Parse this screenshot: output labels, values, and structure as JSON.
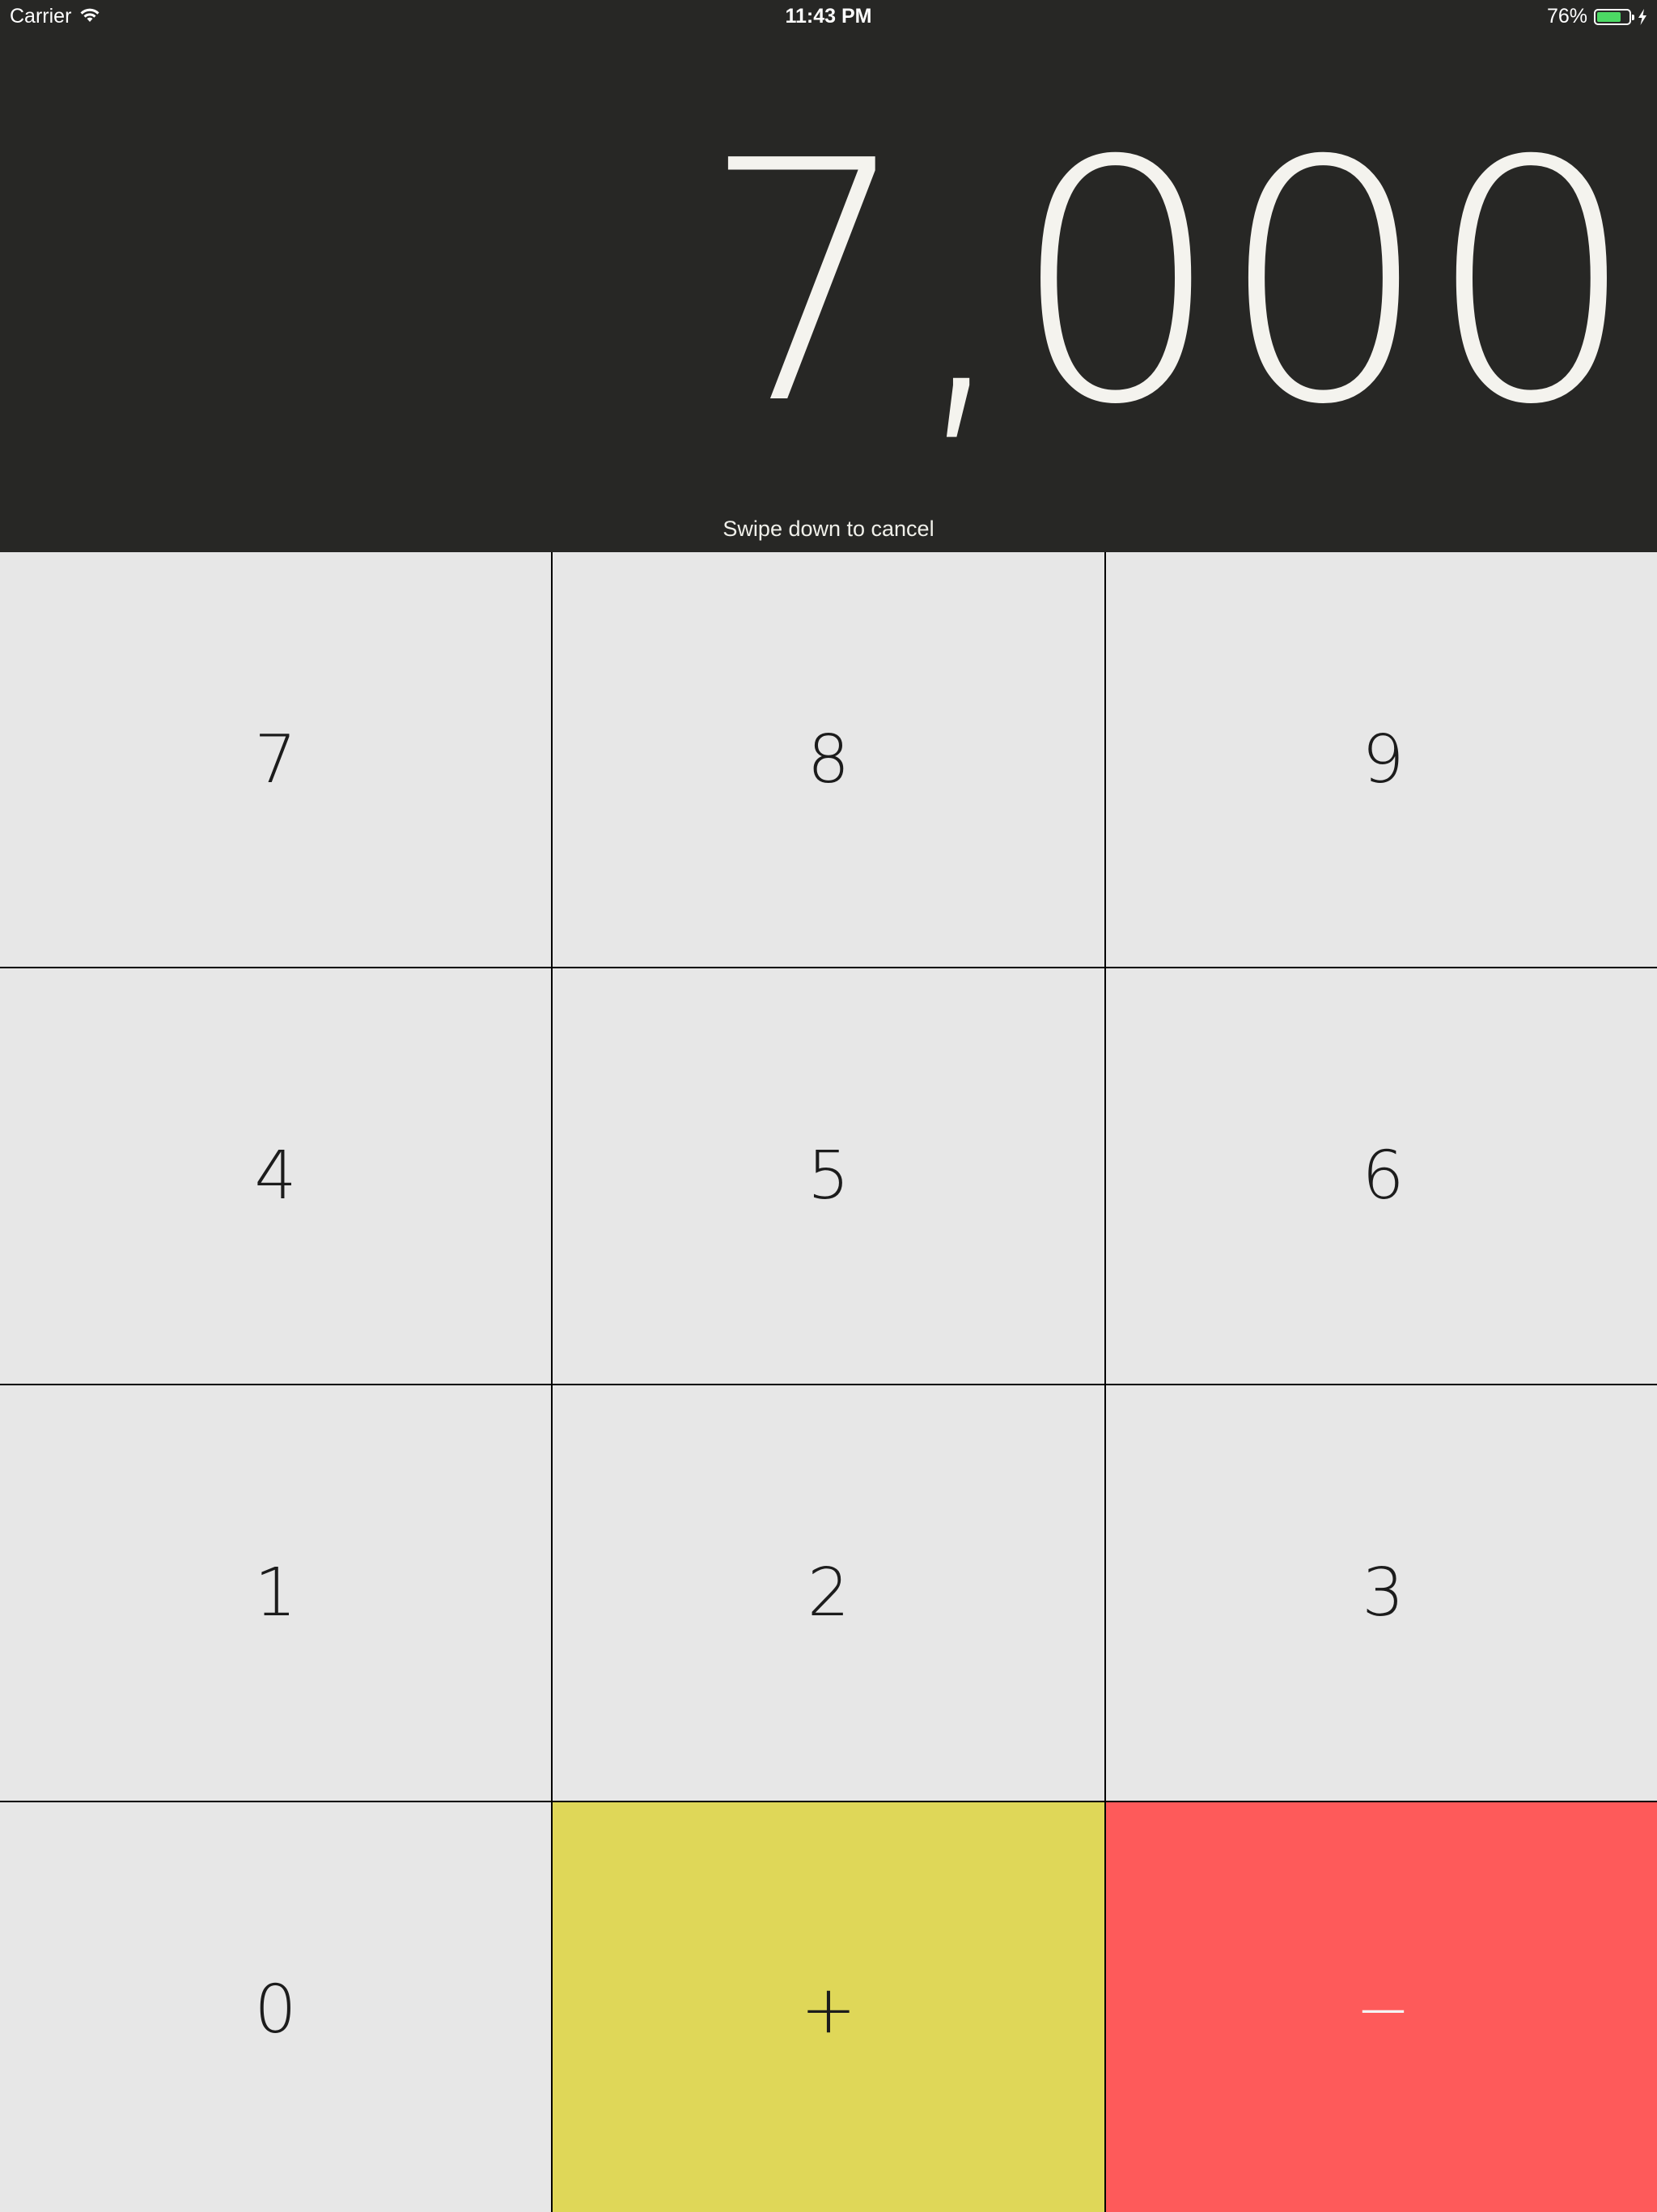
{
  "status_bar": {
    "carrier": "Carrier",
    "time": "11:43 PM",
    "battery_percent": "76%",
    "battery_level": 0.76,
    "wifi_icon": "wifi-icon",
    "battery_icon": "battery-icon",
    "charging_icon": "bolt-icon"
  },
  "display": {
    "value": "7,000",
    "hint": "Swipe down to cancel"
  },
  "keypad": {
    "keys": [
      "7",
      "8",
      "9",
      "4",
      "5",
      "6",
      "1",
      "2",
      "3",
      "0",
      "+",
      "−"
    ]
  },
  "colors": {
    "display_background": "#272725",
    "key_background": "#e7e7e7",
    "plus_background": "#dfd758",
    "minus_background": "#fe5a5a",
    "battery_green": "#4cd964"
  }
}
